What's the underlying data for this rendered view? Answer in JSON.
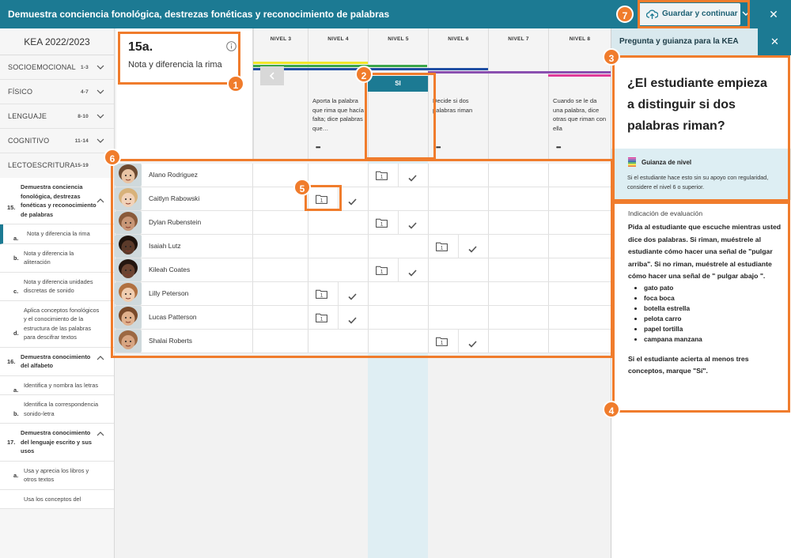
{
  "topbar": {
    "title": "Demuestra conciencia fonológica, destrezas fonéticas y reconocimiento de palabras",
    "save_label": "Guardar y continuar",
    "close_symbol": "✕"
  },
  "sidebar": {
    "heading": "KEA 2022/2023",
    "categories": [
      {
        "label": "SOCIOEMOCIONAL",
        "range": "1-3"
      },
      {
        "label": "FÍSICO",
        "range": "4-7"
      },
      {
        "label": "LENGUAJE",
        "range": "8-10"
      },
      {
        "label": "COGNITIVO",
        "range": "11-14"
      },
      {
        "label": "LECTOESCRITURA",
        "range": "15-19"
      }
    ],
    "sections": [
      {
        "num": "15.",
        "title": "Demuestra conciencia fonológica, destrezas fonéticas y reconocimiento de palabras",
        "items": [
          {
            "letter": "a.",
            "label": "Nota y diferencia la rima"
          },
          {
            "letter": "b.",
            "label": "Nota y diferencia la aliteración"
          },
          {
            "letter": "c.",
            "label": "Nota y diferencia unidades discretas de sonido"
          },
          {
            "letter": "d.",
            "label": "Aplica conceptos fonológicos y el conocimiento de la estructura de las palabras para descifrar textos"
          }
        ]
      },
      {
        "num": "16.",
        "title": "Demuestra conocimiento del alfabeto",
        "items": [
          {
            "letter": "a.",
            "label": "Identifica y nombra las letras"
          },
          {
            "letter": "b.",
            "label": "Identifica la correspondencia sonido-letra"
          }
        ]
      },
      {
        "num": "17.",
        "title": "Demuestra conocimiento del lenguaje escrito y sus usos",
        "items": [
          {
            "letter": "a.",
            "label": "Usa y aprecia los libros y otros textos"
          },
          {
            "letter": "",
            "label": "Usa los conceptos del"
          }
        ]
      }
    ]
  },
  "objective": {
    "code": "15a.",
    "name": "Nota y diferencia la rima"
  },
  "levels": [
    {
      "label": "NIVEL 3",
      "colors": [
        "#1f4ea3"
      ],
      "desc": ""
    },
    {
      "label": "NIVEL 4",
      "colors": [
        "#f0e62a",
        "#3aa54a",
        "#1f4ea3"
      ],
      "desc": "Aporta la palabra que rima que hacía falta; dice palabras que…"
    },
    {
      "label": "NIVEL 5",
      "colors": [
        "#3aa54a",
        "#1f4ea3"
      ],
      "desc": ""
    },
    {
      "label": "NIVEL 6",
      "colors": [
        "#1f4ea3",
        "#8a4fb0"
      ],
      "desc": "Decide si dos palabras riman"
    },
    {
      "label": "NIVEL 7",
      "colors": [
        "#8a4fb0"
      ],
      "desc": ""
    },
    {
      "label": "NIVEL 8",
      "colors": [
        "#8a4fb0",
        "#e03a9a"
      ],
      "desc": "Cuando se le da una palabra, dice otras que riman con ella"
    }
  ],
  "more_symbol": "•••",
  "si_label": "SI",
  "students": [
    {
      "name": "Alano Rodriguez",
      "level": 5
    },
    {
      "name": "Caitlyn Rabowski",
      "level": 4
    },
    {
      "name": "Dylan Rubenstein",
      "level": 5
    },
    {
      "name": "Isaiah Lutz",
      "level": 6
    },
    {
      "name": "Kileah Coates",
      "level": 5
    },
    {
      "name": "Lilly Peterson",
      "level": 4
    },
    {
      "name": "Lucas Patterson",
      "level": 4
    },
    {
      "name": "Shalai Roberts",
      "level": 6
    }
  ],
  "marker_text": "1",
  "right_panel": {
    "header": "Pregunta y guianza para la KEA",
    "question": "¿El estudiante empieza a distinguir si dos palabras riman?",
    "guide_title": "Guianza de nivel",
    "guide_desc": "Si el estudiante hace esto sin su apoyo con regularidad, considere el nivel 6 o superior.",
    "indication_label": "Indicación de evaluación",
    "instructions": "Pida al estudiante que escuche mientras usted dice dos palabras. Si riman, muéstrele al estudiante cómo hacer una señal de \"pulgar arriba\". Si no riman, muéstrele al estudiante cómo hacer una señal de \" pulgar abajo \".",
    "word_pairs": [
      "gato pato",
      "foca boca",
      "botella estrella",
      "pelota carro",
      "papel tortilla",
      "campana manzana"
    ],
    "closing": "Si el estudiante acierta al menos tres conceptos, marque \"Sí\"."
  },
  "annotations": [
    "1",
    "2",
    "3",
    "4",
    "5",
    "6",
    "7"
  ],
  "colors": {
    "teal": "#1c7a93",
    "annotation_orange": "#f07c2c"
  }
}
